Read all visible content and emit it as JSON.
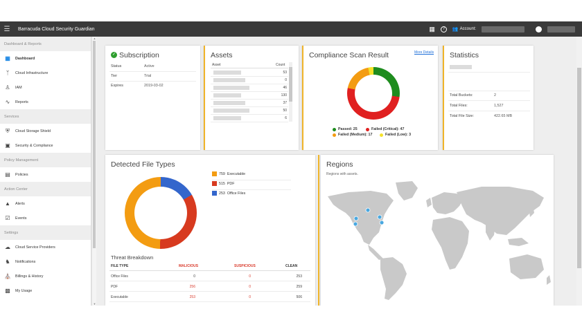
{
  "app": {
    "title": "Barracuda Cloud Security Guardian",
    "account_label": "Account:"
  },
  "sidebar": {
    "sections": [
      {
        "label": "Dashboard & Reports",
        "items": [
          {
            "label": "Dashboard",
            "icon": "dashboard-icon",
            "active": true
          },
          {
            "label": "Cloud Infrastructure",
            "icon": "hierarchy-icon"
          },
          {
            "label": "IAM",
            "icon": "people-icon"
          },
          {
            "label": "Reports",
            "icon": "trend-icon"
          }
        ]
      },
      {
        "label": "Services",
        "items": [
          {
            "label": "Cloud Storage Shield",
            "icon": "shield-icon"
          },
          {
            "label": "Security & Compliance",
            "icon": "lock-icon"
          }
        ]
      },
      {
        "label": "Policy Management",
        "items": [
          {
            "label": "Policies",
            "icon": "policies-icon"
          }
        ]
      },
      {
        "label": "Action Center",
        "items": [
          {
            "label": "Alerts",
            "icon": "warning-icon"
          },
          {
            "label": "Events",
            "icon": "checkbox-icon"
          }
        ]
      },
      {
        "label": "Settings",
        "items": [
          {
            "label": "Cloud Service Providers",
            "icon": "cloud-icon"
          },
          {
            "label": "Notifications",
            "icon": "bell-icon"
          },
          {
            "label": "Billings & History",
            "icon": "bank-icon"
          },
          {
            "label": "My Usage",
            "icon": "usage-icon"
          }
        ]
      }
    ]
  },
  "subscription": {
    "title": "Subscription",
    "rows": [
      {
        "key": "Status",
        "value": "Active"
      },
      {
        "key": "Tier",
        "value": "Trial"
      },
      {
        "key": "Expires",
        "value": "2019-03-02"
      }
    ]
  },
  "assets": {
    "title": "Assets",
    "col_asset": "Asset",
    "col_count": "Count",
    "counts": [
      "53",
      "0",
      "46",
      "130",
      "37",
      "50",
      "6"
    ]
  },
  "compliance": {
    "title": "Compliance Scan Result",
    "more_link": "More Details",
    "legend": [
      {
        "label": "Passed: 25",
        "color": "#1e8c1e",
        "value": 25
      },
      {
        "label": "Failed (Critical): 47",
        "color": "#e02020",
        "value": 47
      },
      {
        "label": "Failed (Medium): 17",
        "color": "#f39c12",
        "value": 17
      },
      {
        "label": "Failed (Low): 3",
        "color": "#f5e22a",
        "value": 3
      }
    ]
  },
  "statistics": {
    "title": "Statistics",
    "rows": [
      {
        "key": "Total Buckets:",
        "value": "2"
      },
      {
        "key": "Total Files:",
        "value": "1,527"
      },
      {
        "key": "Total File Size:",
        "value": "422.65 MB"
      }
    ]
  },
  "file_types": {
    "title": "Detected File Types",
    "legend": [
      {
        "count": "759",
        "label": "Executable",
        "color": "#f39c12",
        "value": 759
      },
      {
        "count": "515",
        "label": "PDF",
        "color": "#d73a1f",
        "value": 515
      },
      {
        "count": "253",
        "label": "Office Files",
        "color": "#3366cc",
        "value": 253
      }
    ],
    "threat_title": "Threat Breakdown",
    "threat_headers": [
      "FILE TYPE",
      "MALICIOUS",
      "SUSPICIOUS",
      "CLEAN"
    ],
    "threat_rows": [
      [
        "Office Files",
        "0",
        "0",
        "253"
      ],
      [
        "PDF",
        "256",
        "0",
        "259"
      ],
      [
        "Executable",
        "253",
        "0",
        "506"
      ]
    ]
  },
  "regions": {
    "title": "Regions",
    "subtitle": "Regions with assets."
  }
}
